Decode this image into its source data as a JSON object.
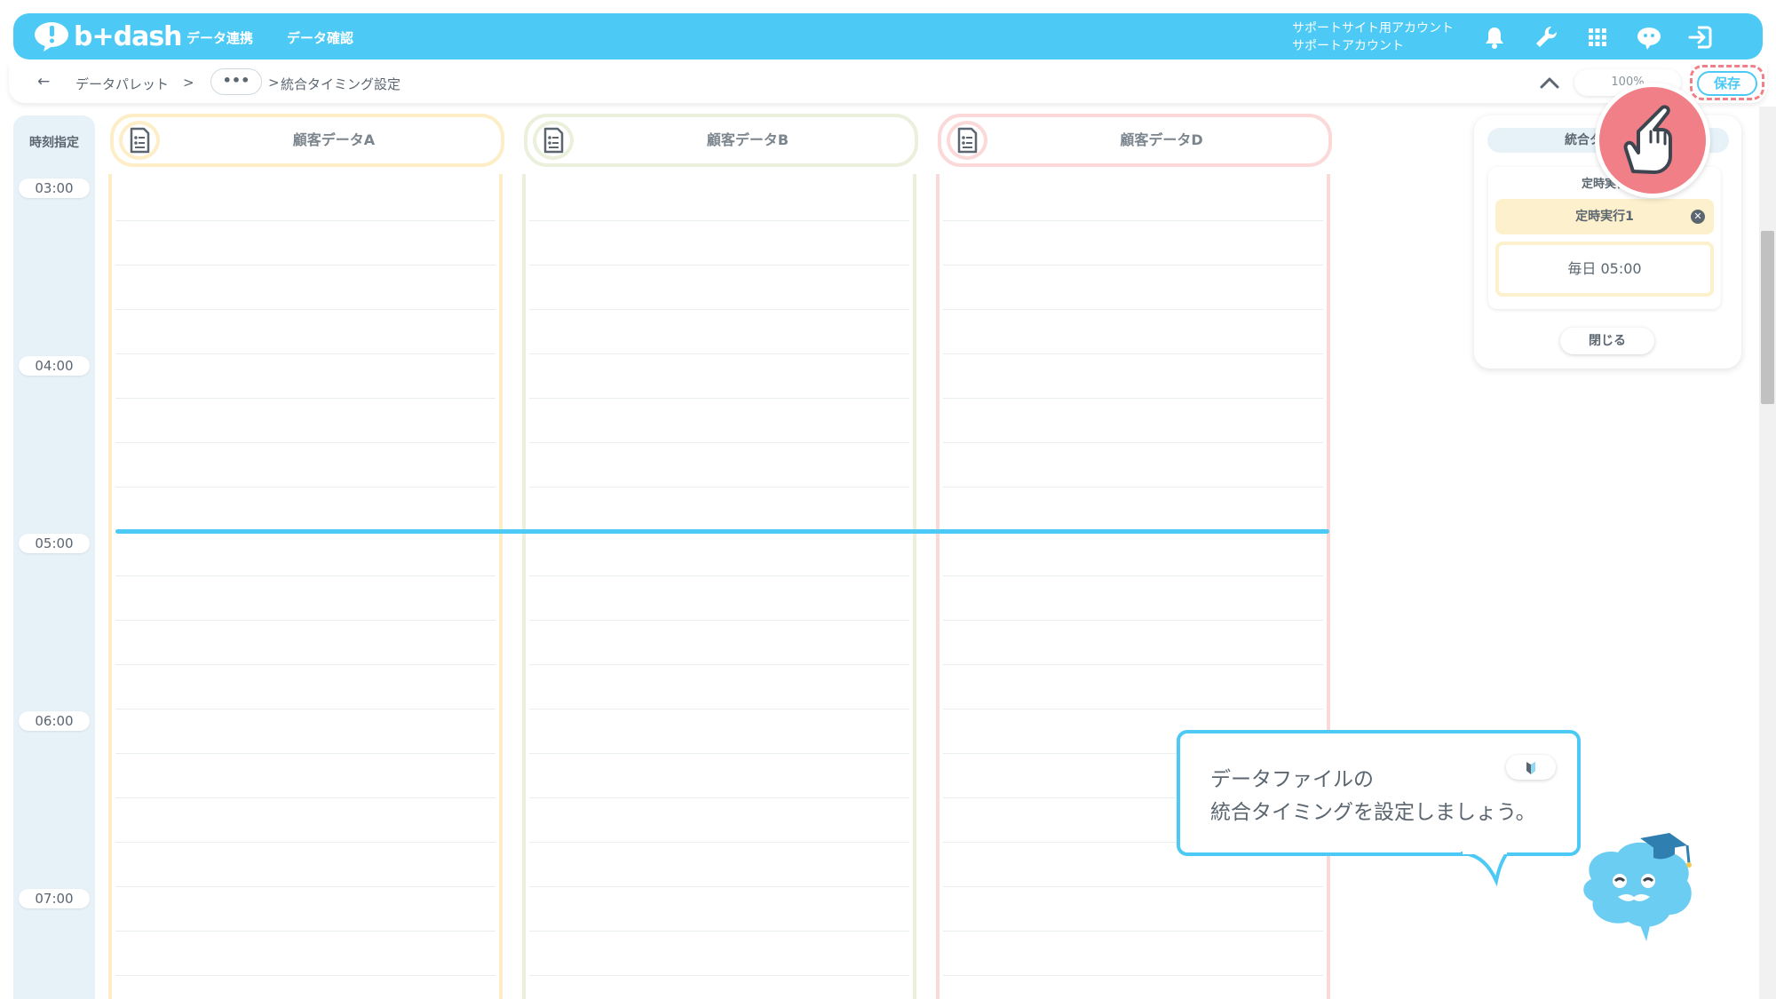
{
  "header": {
    "logo_text": "b+dash",
    "nav": [
      "データ連携",
      "データ確認"
    ],
    "account_line1": "サポートサイト用アカウント",
    "account_line2": "サポートアカウント"
  },
  "breadcrumb": {
    "back": "←",
    "root": "データパレット",
    "sep1": ">",
    "more": "•••",
    "sep2": ">",
    "current": "統合タイミング設定"
  },
  "toolbar": {
    "zoom": "100%",
    "save_label": "保存"
  },
  "timeline": {
    "header_label": "時刻指定",
    "times": [
      "03:00",
      "04:00",
      "05:00",
      "06:00",
      "07:00"
    ],
    "columns": [
      {
        "title": "顧客データA",
        "color": "#fdeec7"
      },
      {
        "title": "顧客データB",
        "color": "#eaf0db"
      },
      {
        "title": "顧客データD",
        "color": "#fbd9d9"
      }
    ]
  },
  "panel": {
    "title": "統合タイミング",
    "subtitle": "定時実行",
    "exec_name": "定時実行1",
    "schedule": "毎日 05:00",
    "close_label": "閉じる"
  },
  "bubble": {
    "line1": "データファイルの",
    "line2": "統合タイミングを設定しましょう。"
  },
  "colors": {
    "accent": "#4ccaf5",
    "highlight": "#f07f87"
  }
}
